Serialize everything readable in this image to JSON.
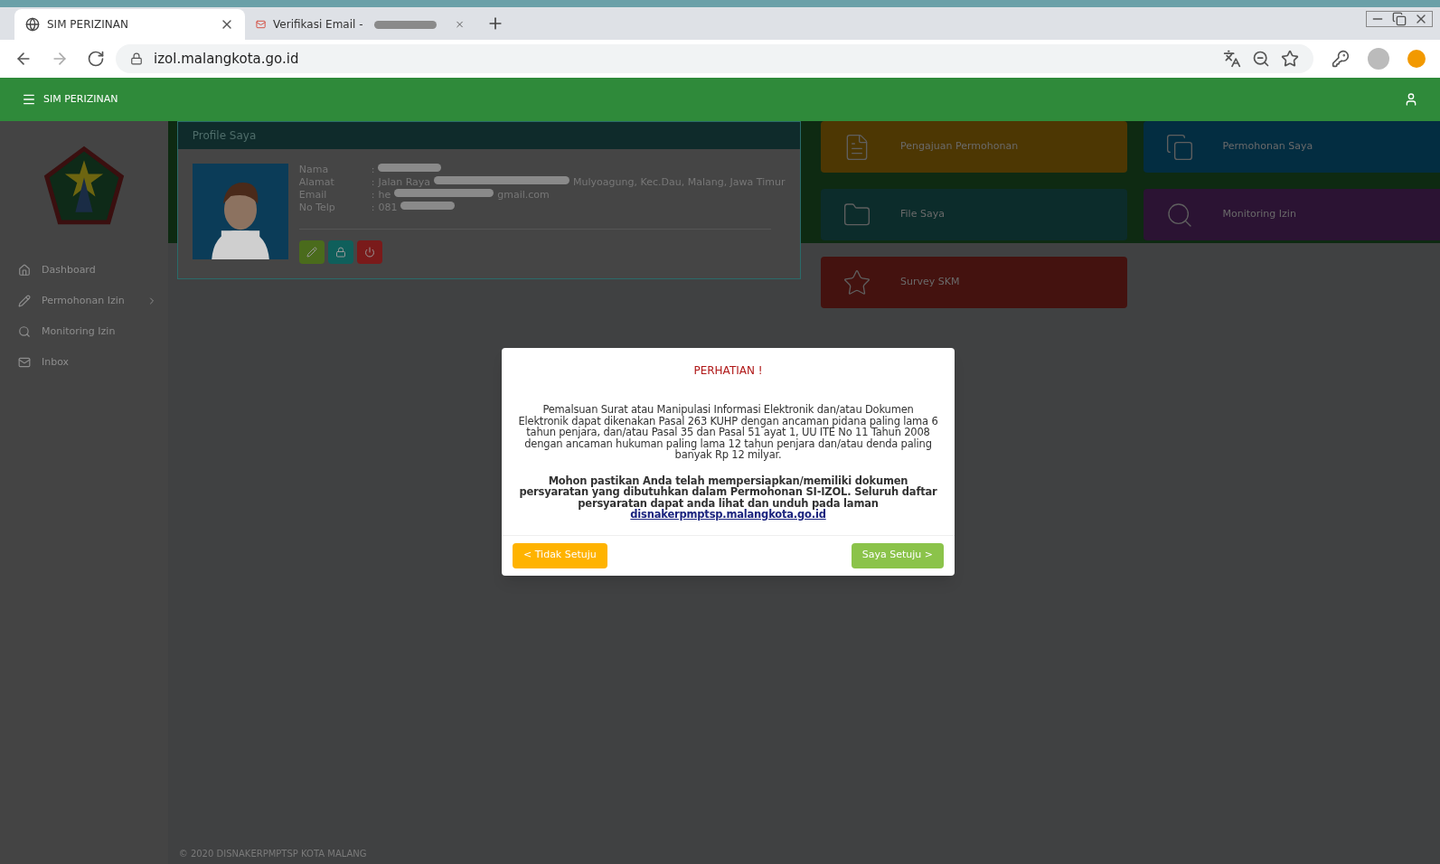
{
  "browser": {
    "tabs": [
      {
        "title": "SIM PERIZINAN",
        "kind": "site",
        "selected": true
      },
      {
        "title": "Verifikasi Email - ",
        "kind": "mail",
        "selected": false
      }
    ],
    "url": "izol.malangkota.go.id"
  },
  "header": {
    "title": "SIM PERIZINAN"
  },
  "sidebar": {
    "items": [
      {
        "label": "Dashboard",
        "kind": "home",
        "has_children": false
      },
      {
        "label": "Permohonan Izin",
        "kind": "edit",
        "has_children": true
      },
      {
        "label": "Monitoring Izin",
        "kind": "search",
        "has_children": false
      },
      {
        "label": "Inbox",
        "kind": "mail",
        "has_children": false
      }
    ]
  },
  "profile": {
    "title": "Profile Saya",
    "fields": [
      {
        "label": "Nama",
        "separator": ":"
      },
      {
        "label": "Alamat",
        "separator": ":",
        "before": "Jalan Raya",
        "after": "Mulyoagung, Kec.Dau, Malang, Jawa Timur"
      },
      {
        "label": "Email",
        "separator": ":",
        "before": "he",
        "after": "gmail.com"
      },
      {
        "label": "No Telp",
        "separator": ":",
        "before": "081"
      }
    ],
    "actions": [
      {
        "kind": "edit",
        "color": "#4a6b1c"
      },
      {
        "kind": "lock",
        "color": "#0f5f5b"
      },
      {
        "kind": "power",
        "color": "#7a1a1a"
      }
    ]
  },
  "tiles": [
    {
      "label": "Pengajuan Permohonan",
      "kind": "document",
      "color": "#4d3703"
    },
    {
      "label": "Permohonan Saya",
      "kind": "copy",
      "color": "#032d41"
    },
    {
      "label": "File Saya",
      "kind": "folder",
      "color": "#0c2c2b"
    },
    {
      "label": "Monitoring Izin",
      "kind": "search",
      "color": "#2b1333"
    },
    {
      "label": "Survey SKM",
      "kind": "star",
      "color": "#44120f"
    }
  ],
  "modal": {
    "title": "PERHATIAN !",
    "paragraph": "Pemalsuan Surat atau Manipulasi Informasi Elektronik dan/atau Dokumen Elektronik dapat dikenakan Pasal 263 KUHP dengan ancaman pidana paling lama 6 tahun penjara, dan/atau Pasal 35 dan Pasal 51 ayat 1, UU ITE No 11 Tahun 2008 dengan ancaman hukuman paling lama 12 tahun penjara dan/atau denda paling banyak Rp 12 milyar.",
    "notice": "Mohon pastikan Anda telah mempersiapkan/memiliki dokumen persyaratan yang dibutuhkan dalam Permohonan SI-IZOL. Seluruh daftar persyaratan dapat anda lihat dan unduh pada laman",
    "link": "disnakerpmptsp.malangkota.go.id",
    "buttons": [
      {
        "label": "< Tidak Setuju",
        "kind": "reject"
      },
      {
        "label": "Saya Setuju >",
        "kind": "accept"
      }
    ]
  },
  "footer": "© 2020 DISNAKERPMPTSP KOTA MALANG"
}
